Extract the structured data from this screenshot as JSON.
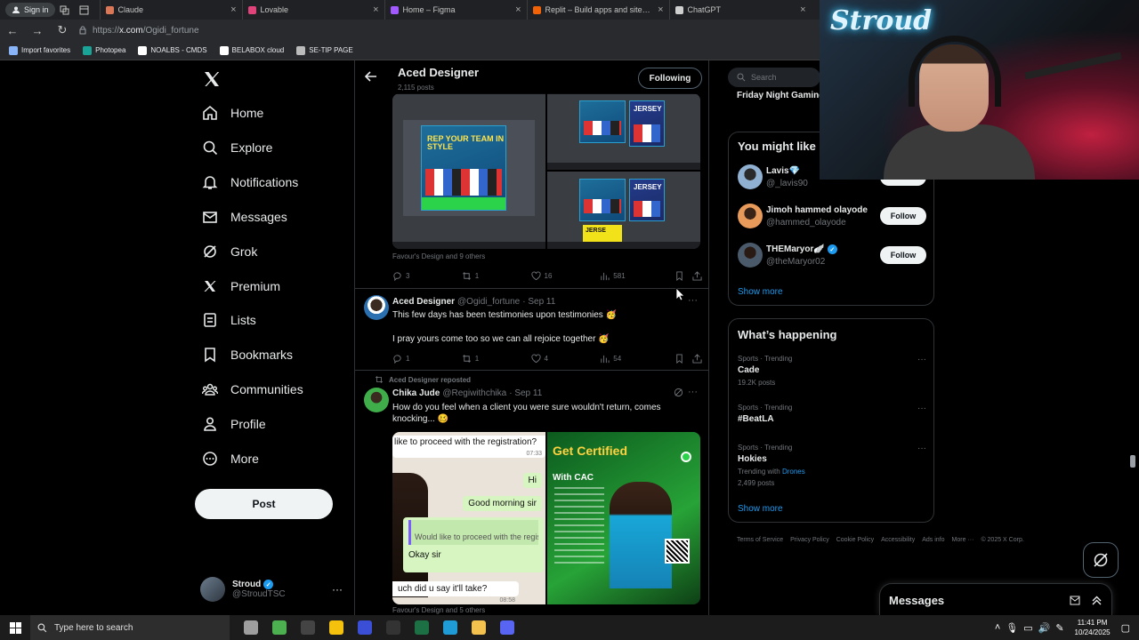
{
  "browser": {
    "signin_label": "Sign in",
    "tabs": [
      {
        "title": "Claude",
        "color": "#d97757"
      },
      {
        "title": "Lovable",
        "color": "#e0437a"
      },
      {
        "title": "Home – Figma",
        "color": "#a259ff"
      },
      {
        "title": "Replit – Build apps and sites with AI",
        "color": "#f26207"
      },
      {
        "title": "ChatGPT",
        "color": "#cfcfcf"
      }
    ],
    "url_prefix": "https://",
    "url_domain": "x.com",
    "url_path": "/Ogidi_fortune",
    "bookmarks": [
      {
        "label": "Import favorites",
        "color": "#8ab4f8"
      },
      {
        "label": "Photopea",
        "color": "#18a497"
      },
      {
        "label": "NOALBS - CMDS",
        "color": "#ffffff"
      },
      {
        "label": "BELABOX cloud",
        "color": "#ffffff"
      },
      {
        "label": "SE-TIP PAGE",
        "color": "#bbbbbb"
      }
    ]
  },
  "nav": {
    "items": [
      {
        "label": "Home",
        "icon": "home-icon"
      },
      {
        "label": "Explore",
        "icon": "search-icon"
      },
      {
        "label": "Notifications",
        "icon": "bell-icon"
      },
      {
        "label": "Messages",
        "icon": "envelope-icon"
      },
      {
        "label": "Grok",
        "icon": "grok-icon"
      },
      {
        "label": "Premium",
        "icon": "x-premium-icon"
      },
      {
        "label": "Lists",
        "icon": "list-icon"
      },
      {
        "label": "Bookmarks",
        "icon": "bookmark-icon"
      },
      {
        "label": "Communities",
        "icon": "communities-icon"
      },
      {
        "label": "Profile",
        "icon": "person-icon"
      },
      {
        "label": "More",
        "icon": "more-circle-icon"
      }
    ],
    "post_label": "Post",
    "account_name": "Stroud",
    "account_handle": "@StroudTSC"
  },
  "profile_header": {
    "name": "Aced Designer",
    "posts": "2,115 posts",
    "following_label": "Following"
  },
  "media_top": {
    "flyer_text": "REP YOUR TEAM IN STYLE",
    "jersey_text": "JERSEY",
    "jerse_text": "JERSE"
  },
  "tweet1": {
    "likers": "Favour's Design and 9 others",
    "replies": "3",
    "reposts": "1",
    "likes": "16",
    "views": "581"
  },
  "tweet2": {
    "name": "Aced Designer",
    "handle": "@Ogidi_fortune",
    "date": "· Sep 11",
    "line1": "This few days has been testimonies upon testimonies 🥳",
    "line2": "I pray yours come too so we can all rejoice together 🥳",
    "replies": "1",
    "reposts": "1",
    "likes": "4",
    "views": "54"
  },
  "tweet3": {
    "repost_label": "Aced Designer reposted",
    "name": "Chika Jude",
    "handle": "@Regiwithchika",
    "date": "· Sep 11",
    "text": "How do you feel when a client you were sure wouldn't return, comes knocking... 🥴",
    "chat_q": "like to proceed with the registration?",
    "chat_q_time": "07:33",
    "chat_hi": "Hi",
    "chat_gm": "Good morning sir",
    "chat_quote": "Would like to proceed with the regis",
    "chat_okay": "Okay sir",
    "chat_last": "uch did u say it'll take?",
    "chat_last_time": "08:58",
    "cert_title": "Get Certified",
    "cert_sub": "With CAC",
    "likers": "Favour's Design and 5 others"
  },
  "right": {
    "search_placeholder": "Search",
    "top_trend": "Friday Night Gaming",
    "might_like_title": "You might like",
    "suggestions": [
      {
        "name": "Lavis💎",
        "handle": "@_lavis90",
        "follow": "Follow",
        "verified": false
      },
      {
        "name": "Jimoh hammed olayode",
        "handle": "@hammed_olayode",
        "follow": "Follow",
        "verified": false
      },
      {
        "name": "THEMaryor🪽",
        "handle": "@theMaryor02",
        "follow": "Follow",
        "verified": true
      }
    ],
    "show_more": "Show more",
    "happening_title": "What’s happening",
    "trends": [
      {
        "category": "Sports · Trending",
        "title": "Cade",
        "posts": "19.2K posts"
      },
      {
        "category": "Sports · Trending",
        "title": "#BeatLA",
        "posts": ""
      },
      {
        "category": "Sports · Trending",
        "title": "Hokies",
        "trending_with_label": "Trending with",
        "trending_with": "Drones",
        "posts": "2,499 posts"
      }
    ],
    "show_more2": "Show more",
    "footer": [
      "Terms of Service",
      "Privacy Policy",
      "Cookie Policy",
      "Accessibility",
      "Ads info",
      "More ···",
      "© 2025 X Corp."
    ],
    "messages_title": "Messages"
  },
  "webcam": {
    "logo_text": "Stroud"
  },
  "taskbar": {
    "search_placeholder": "Type here to search",
    "time": "11:41 PM",
    "date": "10/24/2025",
    "apps": [
      {
        "name": "task-view",
        "color": "#9e9e9e"
      },
      {
        "name": "chrome",
        "color": "#4caf50"
      },
      {
        "name": "obs",
        "color": "#444"
      },
      {
        "name": "store",
        "color": "#f4c20d"
      },
      {
        "name": "notion",
        "color": "#3a4fd6"
      },
      {
        "name": "epic",
        "color": "#333"
      },
      {
        "name": "excel",
        "color": "#1d7044"
      },
      {
        "name": "edge",
        "color": "#1f9bd6"
      },
      {
        "name": "explorer",
        "color": "#f2c14e"
      },
      {
        "name": "discord",
        "color": "#5865f2"
      }
    ]
  }
}
